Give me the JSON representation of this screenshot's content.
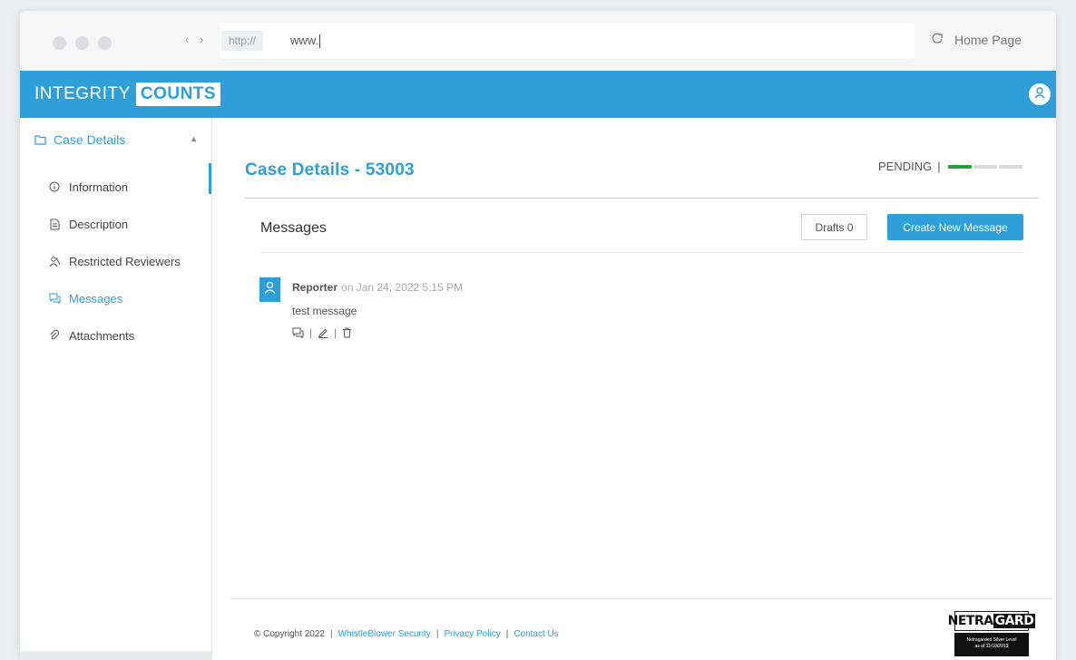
{
  "browser": {
    "nav_arrows": "‹ ›",
    "protocol": "http://",
    "url": "www.",
    "home_label": "Home Page"
  },
  "header": {
    "logo_part1": "INTEGRITY",
    "logo_part2": "COUNTS",
    "accent_color": "#2f9fd9"
  },
  "sidebar": {
    "section_label": "Case Details",
    "items": [
      {
        "label": "Information",
        "icon": "info-icon"
      },
      {
        "label": "Description",
        "icon": "document-icon"
      },
      {
        "label": "Restricted Reviewers",
        "icon": "reviewers-icon"
      },
      {
        "label": "Messages",
        "icon": "messages-icon",
        "active": true
      },
      {
        "label": "Attachments",
        "icon": "paperclip-icon"
      }
    ]
  },
  "main": {
    "case_title": "Case Details - 53003",
    "status_label": "PENDING",
    "status_sep": "|",
    "status_progress_steps": 3,
    "status_progress_done": 1,
    "status_color": "#1fa33a",
    "messages_title": "Messages",
    "drafts_label": "Drafts 0",
    "create_label": "Create New Message",
    "message": {
      "author": "Reporter",
      "meta": "on Jan 24, 2022 5:15 PM",
      "body": "test message"
    }
  },
  "footer": {
    "copyright": "© Copyright 2022",
    "link1": "WhistleBlower Security",
    "link2": "Privacy Policy",
    "link3": "Contact Us",
    "badge_word1": "NETRA",
    "badge_word2": "GARD",
    "badge_line1": "Netragarded Silver Level",
    "badge_line2": "as of 11/10/2019"
  }
}
